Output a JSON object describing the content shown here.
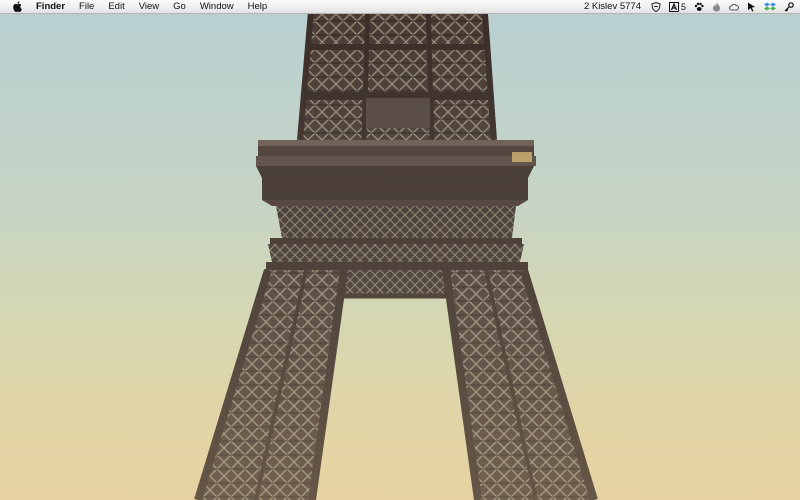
{
  "menubar": {
    "apple_icon": "apple-icon",
    "app_name": "Finder",
    "menus": [
      "File",
      "Edit",
      "View",
      "Go",
      "Window",
      "Help"
    ],
    "date": "2 Kislev 5774",
    "adobe_count": "5",
    "status_icons": [
      "shield-icon",
      "adobe-icon",
      "paw-icon",
      "flame-icon",
      "cloud-icon",
      "cursor-icon",
      "dropbox-icon",
      "key-icon"
    ]
  },
  "wallpaper": {
    "subject": "eiffel-tower",
    "sky_top": "#b7cfd1",
    "sky_bottom": "#e6d2a0",
    "iron_color": "#4a3a34"
  }
}
